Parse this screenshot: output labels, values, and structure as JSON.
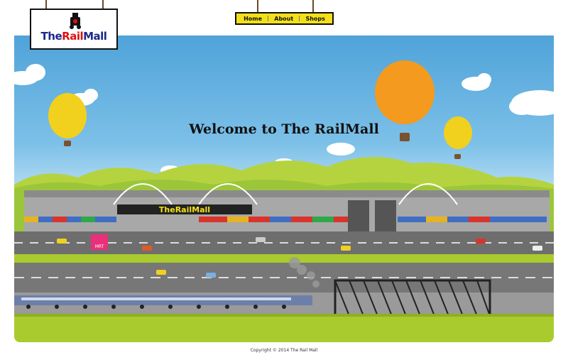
{
  "header": {
    "logo": {
      "text_main": "The",
      "text_accent": "Rail",
      "text_end": "Mall",
      "icon": "locomotive-icon"
    },
    "nav": [
      {
        "label": "Home"
      },
      {
        "label": "About"
      },
      {
        "label": "Shops"
      }
    ]
  },
  "hero": {
    "welcome_text": "Welcome to The RailMall",
    "signage": {
      "mall_sign": "TheRailMall",
      "station_sign": "MRT"
    }
  },
  "footer": {
    "copyright": "Copyright © 2014 The Rail Mall"
  },
  "colors": {
    "nav_bg": "#f4e01a",
    "logo_blue": "#1c2a8a",
    "logo_red": "#dd1111",
    "sky_top": "#4fa3d9",
    "hill_green": "#9cc63a",
    "grass": "#a9cb2e",
    "road": "#6e6e6e",
    "balloon_orange": "#f39a1f",
    "balloon_yellow": "#f2d01e"
  }
}
